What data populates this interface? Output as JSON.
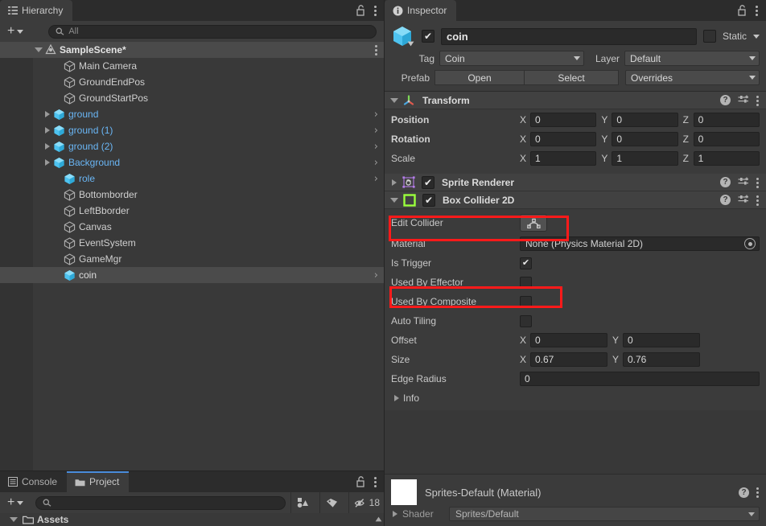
{
  "hierarchy": {
    "tab_label": "Hierarchy",
    "tab_icon": "hierarchy-icon",
    "lock_icon": "lock-open-icon",
    "menu_icon": "kebab-menu-icon",
    "create_label": "+",
    "search_placeholder": "All",
    "search_value": "",
    "search_icon": "search-icon",
    "scene": {
      "label": "SampleScene*",
      "icon": "unity-scene-icon",
      "expanded": true
    },
    "items": [
      {
        "label": "Main Camera",
        "type": "gameobject",
        "indent": 2,
        "expandable": false,
        "chevron": false,
        "selected": false
      },
      {
        "label": "GroundEndPos",
        "type": "gameobject",
        "indent": 2,
        "expandable": false,
        "chevron": false,
        "selected": false
      },
      {
        "label": "GroundStartPos",
        "type": "gameobject",
        "indent": 2,
        "expandable": false,
        "chevron": false,
        "selected": false
      },
      {
        "label": "ground",
        "type": "prefab",
        "indent": 1,
        "expandable": true,
        "chevron": true,
        "selected": false
      },
      {
        "label": "ground (1)",
        "type": "prefab",
        "indent": 1,
        "expandable": true,
        "chevron": true,
        "selected": false
      },
      {
        "label": "ground (2)",
        "type": "prefab",
        "indent": 1,
        "expandable": true,
        "chevron": true,
        "selected": false
      },
      {
        "label": "Background",
        "type": "prefab",
        "indent": 1,
        "expandable": true,
        "chevron": true,
        "selected": false
      },
      {
        "label": "role",
        "type": "prefab",
        "indent": 2,
        "expandable": false,
        "chevron": true,
        "selected": false
      },
      {
        "label": "Bottomborder",
        "type": "gameobject",
        "indent": 2,
        "expandable": false,
        "chevron": false,
        "selected": false
      },
      {
        "label": "LeftBborder",
        "type": "gameobject",
        "indent": 2,
        "expandable": false,
        "chevron": false,
        "selected": false
      },
      {
        "label": "Canvas",
        "type": "gameobject",
        "indent": 2,
        "expandable": false,
        "chevron": false,
        "selected": false
      },
      {
        "label": "EventSystem",
        "type": "gameobject",
        "indent": 2,
        "expandable": false,
        "chevron": false,
        "selected": false
      },
      {
        "label": "GameMgr",
        "type": "gameobject",
        "indent": 2,
        "expandable": false,
        "chevron": false,
        "selected": false
      },
      {
        "label": "coin",
        "type": "prefab-sel",
        "indent": 2,
        "expandable": false,
        "chevron": true,
        "selected": true
      }
    ]
  },
  "project": {
    "tabs": [
      {
        "label": "Console",
        "icon": "console-icon",
        "active": false
      },
      {
        "label": "Project",
        "icon": "folder-icon",
        "active": true
      }
    ],
    "lock_icon": "lock-open-icon",
    "menu_icon": "kebab-menu-icon",
    "create_label": "+",
    "search_placeholder": "",
    "search_value": "",
    "search_icon": "search-icon",
    "toolbar_buttons": [
      {
        "icon": "shapes-filter-icon",
        "label": ""
      },
      {
        "icon": "label-tag-icon",
        "label": ""
      },
      {
        "icon": "hidden-eye-icon",
        "label": "18"
      }
    ],
    "tree_root": {
      "label": "Assets",
      "icon": "folder-icon",
      "expanded": true
    }
  },
  "inspector": {
    "tab_label": "Inspector",
    "tab_icon": "info-icon",
    "lock_icon": "lock-open-icon",
    "menu_icon": "kebab-menu-icon",
    "object_icon": "prefab-cube-icon",
    "enabled_checkbox": true,
    "name": "coin",
    "static_label": "Static",
    "static_checked": false,
    "tag_label": "Tag",
    "tag_value": "Coin",
    "layer_label": "Layer",
    "layer_value": "Default",
    "prefab_label": "Prefab",
    "prefab_open": "Open",
    "prefab_select": "Select",
    "prefab_overrides": "Overrides",
    "components": [
      {
        "name": "Transform",
        "icon": "transform-axis-icon",
        "expanded": true,
        "has_checkbox": false,
        "help_icon": "help-icon",
        "preset_icon": "preset-icon",
        "menu_icon": "kebab-menu-icon",
        "rows": [
          {
            "label": "Position",
            "bold": true,
            "axes": [
              "X",
              "Y",
              "Z"
            ],
            "values": [
              "0",
              "0",
              "0"
            ]
          },
          {
            "label": "Rotation",
            "bold": true,
            "axes": [
              "X",
              "Y",
              "Z"
            ],
            "values": [
              "0",
              "0",
              "0"
            ]
          },
          {
            "label": "Scale",
            "bold": false,
            "axes": [
              "X",
              "Y",
              "Z"
            ],
            "values": [
              "1",
              "1",
              "1"
            ]
          }
        ]
      },
      {
        "name": "Sprite Renderer",
        "icon": "sprite-renderer-icon",
        "expanded": false,
        "has_checkbox": true,
        "checked": true,
        "help_icon": "help-icon",
        "preset_icon": "preset-icon",
        "menu_icon": "kebab-menu-icon"
      },
      {
        "name": "Box Collider 2D",
        "icon": "box-collider-2d-icon",
        "expanded": true,
        "has_checkbox": true,
        "checked": true,
        "highlighted": true,
        "help_icon": "help-icon",
        "preset_icon": "preset-icon",
        "menu_icon": "kebab-menu-icon",
        "edit_collider_label": "Edit Collider",
        "edit_collider_icon": "edit-collider-icon",
        "material_label": "Material",
        "material_value": "None (Physics Material 2D)",
        "material_picker_icon": "object-picker-icon",
        "toggles": [
          {
            "label": "Is Trigger",
            "checked": true,
            "highlighted": true
          },
          {
            "label": "Used By Effector",
            "checked": false,
            "highlighted": false
          },
          {
            "label": "Used By Composite",
            "checked": false,
            "highlighted": false
          },
          {
            "label": "Auto Tiling",
            "checked": false,
            "highlighted": false
          }
        ],
        "offset_label": "Offset",
        "offset_axes": [
          "X",
          "Y"
        ],
        "offset_values": [
          "0",
          "0"
        ],
        "size_label": "Size",
        "size_axes": [
          "X",
          "Y"
        ],
        "size_values": [
          "0.67",
          "0.76"
        ],
        "edge_radius_label": "Edge Radius",
        "edge_radius_value": "0",
        "info_label": "Info"
      }
    ],
    "material_preview": {
      "title": "Sprites-Default (Material)",
      "swatch_color": "#ffffff",
      "shader_label": "Shader",
      "shader_value": "Sprites/Default",
      "help_icon": "help-icon",
      "menu_icon": "kebab-menu-icon"
    }
  },
  "colors": {
    "panel_bg": "#383838",
    "header_bg": "#3c3c3c",
    "component_header": "#414141",
    "field_bg": "#2a2a2a",
    "prefab_blue": "#6ab6f5",
    "accent_blue": "#4a8ddc",
    "annotation_red": "#ff1a1a",
    "collider_green": "#9aff3c",
    "text": "#c4c4c4"
  }
}
